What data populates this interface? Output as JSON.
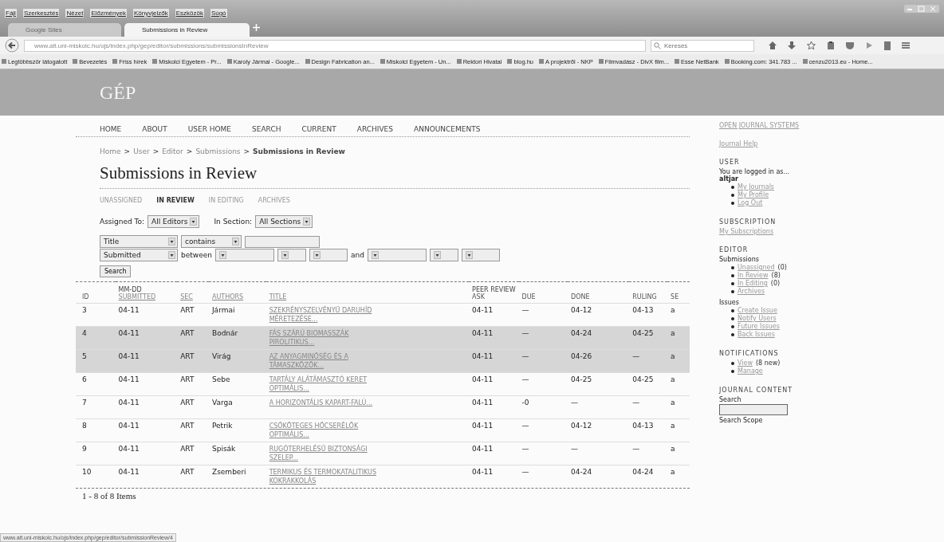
{
  "browser": {
    "menu": [
      "Fájl",
      "Szerkesztés",
      "Nézet",
      "Előzmények",
      "Könyvjelzők",
      "Eszközök",
      "Súgó"
    ],
    "tabs": [
      {
        "label": "Google Sites",
        "selected": false
      },
      {
        "label": "Submissions in Review",
        "selected": true
      }
    ],
    "url": "www.alt.uni-miskolc.hu/ojs/index.php/gep/editor/submissions/submissionsInReview",
    "search_placeholder": "Keresés",
    "bookmarks": [
      "Legtöbbször látogatott",
      "Bevezetés",
      "Friss hírek",
      "Miskolci Egyetem - Pr...",
      "Karoly Jármai - Google...",
      "Design Fabrication an...",
      "Miskolci Egyetem - Un...",
      "Rektori Hivatal",
      "blog.hu",
      "A projektről - NKP",
      "Filmvadász - DivX film...",
      "Esse NetBank",
      "Booking.com: 341.783 ...",
      "cenzu2013.eu - Home..."
    ],
    "status_url": "www.alt.uni-miskolc.hu/ojs/index.php/gep/editor/submissionReview/4"
  },
  "site": {
    "title": "GÉP",
    "nav": [
      "HOME",
      "ABOUT",
      "USER HOME",
      "SEARCH",
      "CURRENT",
      "ARCHIVES",
      "ANNOUNCEMENTS"
    ],
    "breadcrumb": [
      {
        "label": "Home",
        "current": false
      },
      {
        "label": "User",
        "current": false
      },
      {
        "label": "Editor",
        "current": false
      },
      {
        "label": "Submissions",
        "current": false
      },
      {
        "label": "Submissions in Review",
        "current": true
      }
    ],
    "breadcrumb_separator": ">",
    "heading": "Submissions in Review",
    "subtabs": [
      {
        "label": "UNASSIGNED",
        "selected": false
      },
      {
        "label": "IN REVIEW",
        "selected": true
      },
      {
        "label": "IN EDITING",
        "selected": false
      },
      {
        "label": "ARCHIVES",
        "selected": false
      }
    ],
    "filters": {
      "assigned_label": "Assigned To:",
      "assigned_value": "All Editors",
      "section_label": "In Section:",
      "section_value": "All Sections",
      "field": "Title",
      "operator": "contains",
      "date_field": "Submitted",
      "between": "between",
      "and": "and",
      "search_button": "Search"
    },
    "table": {
      "columns": [
        {
          "label": "ID",
          "sortable": false
        },
        {
          "top": "MM-DD",
          "label": "SUBMITTED",
          "sortable": true
        },
        {
          "label": "SEC",
          "sortable": true
        },
        {
          "label": "AUTHORS",
          "sortable": true
        },
        {
          "label": "TITLE",
          "sortable": true
        },
        {
          "top": "PEER REVIEW",
          "label": "ASK",
          "sortable": false
        },
        {
          "label": "DUE",
          "sortable": false
        },
        {
          "label": "DONE",
          "sortable": false
        },
        {
          "label": "RULING",
          "sortable": false
        },
        {
          "label": "SE",
          "sortable": false
        }
      ],
      "rows": [
        {
          "id": "3",
          "submitted": "04-11",
          "sec": "ART",
          "author": "Jármai",
          "title": "SZEKRÉNYSZELVÉNYŰ DARUHÍD MÉRETEZÉSE...",
          "ask": "04-11",
          "due": "—",
          "done": "04-12",
          "ruling": "04-13",
          "se": "a",
          "highlighted": false
        },
        {
          "id": "4",
          "submitted": "04-11",
          "sec": "ART",
          "author": "Bodnár",
          "title": "FÁS SZÁRÚ BIOMASSZÁK PIROLITIKUS...",
          "ask": "04-11",
          "due": "—",
          "done": "04-24",
          "ruling": "04-25",
          "se": "a",
          "highlighted": true
        },
        {
          "id": "5",
          "submitted": "04-11",
          "sec": "ART",
          "author": "Virág",
          "title": "AZ ANYAGMINŐSÉG ÉS A TÁMASZKÖZÖK...",
          "ask": "04-11",
          "due": "—",
          "done": "04-26",
          "ruling": "—",
          "se": "a",
          "highlighted": true
        },
        {
          "id": "6",
          "submitted": "04-11",
          "sec": "ART",
          "author": "Sebe",
          "title": "TARTÁLY ALÁTÁMASZTÓ KERET OPTIMÁLIS...",
          "ask": "04-11",
          "due": "—",
          "done": "04-25",
          "ruling": "04-25",
          "se": "a",
          "highlighted": false
        },
        {
          "id": "7",
          "submitted": "04-11",
          "sec": "ART",
          "author": "Varga",
          "title": "A HORIZONTÁLIS KAPART-FALÚ...",
          "ask": "04-11",
          "due": "-0",
          "done": "—",
          "ruling": "—",
          "se": "a",
          "highlighted": false
        },
        {
          "id": "8",
          "submitted": "04-11",
          "sec": "ART",
          "author": "Petrik",
          "title": "CSŐKÖTEGES HŐCSERÉLŐK OPTIMÁLIS...",
          "ask": "04-11",
          "due": "—",
          "done": "04-12",
          "ruling": "04-13",
          "se": "a",
          "highlighted": false
        },
        {
          "id": "9",
          "submitted": "04-11",
          "sec": "ART",
          "author": "Spisák",
          "title": "RUGÓTERHELÉSŰ BIZTONSÁGI SZELEP...",
          "ask": "04-11",
          "due": "—",
          "done": "—",
          "ruling": "—",
          "se": "a",
          "highlighted": false
        },
        {
          "id": "10",
          "submitted": "04-11",
          "sec": "ART",
          "author": "Zsemberi",
          "title": "TERMIKUS ÉS TERMOKATALITIKUS KOKRAKKOLÁS",
          "ask": "04-11",
          "due": "—",
          "done": "04-24",
          "ruling": "04-24",
          "se": "a",
          "highlighted": false
        }
      ]
    },
    "footer": "1 - 8 of 8 Items"
  },
  "sidebar": {
    "top_links": [
      "OPEN JOURNAL SYSTEMS",
      "Journal Help"
    ],
    "blocks": [
      {
        "heading": "USER",
        "content": [
          {
            "kind": "text",
            "text": "You are logged in as..."
          },
          {
            "kind": "user",
            "text": "altjar"
          },
          {
            "kind": "list",
            "items": [
              {
                "label": "My Journals"
              },
              {
                "label": "My Profile"
              },
              {
                "label": "Log Out"
              }
            ]
          }
        ]
      },
      {
        "heading": "SUBSCRIPTION",
        "content": [
          {
            "kind": "link",
            "text": "My Subscriptions"
          }
        ]
      },
      {
        "heading": "EDITOR",
        "content": [
          {
            "kind": "label",
            "text": "Submissions"
          },
          {
            "kind": "list",
            "items": [
              {
                "label": "Unassigned",
                "count": "(0)"
              },
              {
                "label": "In Review",
                "count": "(8)"
              },
              {
                "label": "In Editing",
                "count": "(0)"
              },
              {
                "label": "Archives"
              }
            ]
          },
          {
            "kind": "label",
            "text": "Issues"
          },
          {
            "kind": "list",
            "items": [
              {
                "label": "Create Issue"
              },
              {
                "label": "Notify Users"
              },
              {
                "label": "Future Issues"
              },
              {
                "label": "Back Issues"
              }
            ]
          }
        ]
      },
      {
        "heading": "NOTIFICATIONS",
        "content": [
          {
            "kind": "list",
            "items": [
              {
                "label": "View",
                "count": "(8 new)"
              },
              {
                "label": "Manage"
              }
            ]
          }
        ]
      },
      {
        "heading": "JOURNAL CONTENT",
        "content": [
          {
            "kind": "label",
            "text": "Search"
          },
          {
            "kind": "field"
          },
          {
            "kind": "label",
            "text": "Search Scope"
          }
        ]
      }
    ]
  }
}
